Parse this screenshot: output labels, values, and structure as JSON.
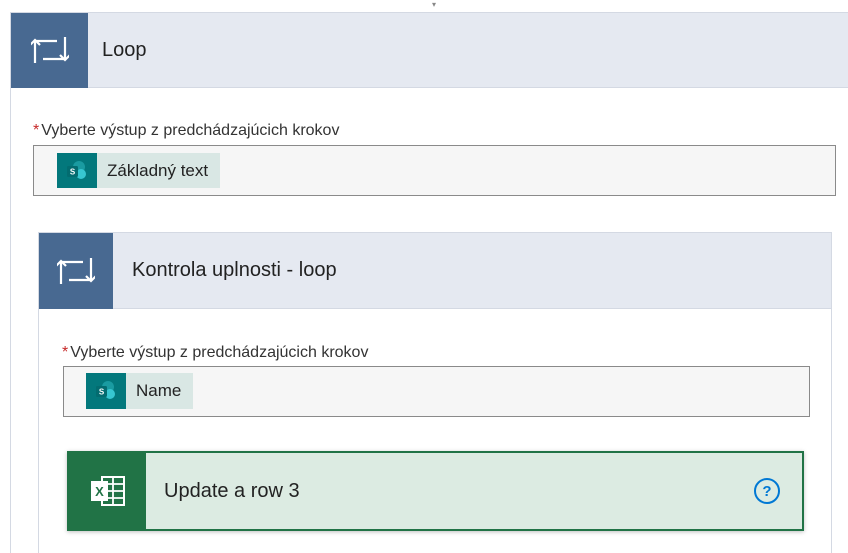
{
  "outer_loop": {
    "title": "Loop",
    "icon": "loop-icon",
    "field": {
      "required_mark": "*",
      "label": "Vyberte výstup z predchádzajúcich krokov",
      "token": {
        "icon": "sharepoint-icon",
        "text": "Základný text"
      }
    }
  },
  "inner_loop": {
    "title": "Kontrola uplnosti - loop",
    "icon": "loop-icon",
    "field": {
      "required_mark": "*",
      "label": "Vyberte výstup z predchádzajúcich krokov",
      "token": {
        "icon": "sharepoint-icon",
        "text": "Name"
      }
    },
    "action": {
      "title": "Update a row 3",
      "icon": "excel-icon",
      "help_icon": "help-icon",
      "help_glyph": "?"
    }
  },
  "colors": {
    "loop_header_bg": "#e5e9f1",
    "loop_icon_bg": "#486991",
    "sharepoint": "#03787c",
    "excel": "#217346",
    "help": "#0078d4",
    "required": "#c62828"
  }
}
